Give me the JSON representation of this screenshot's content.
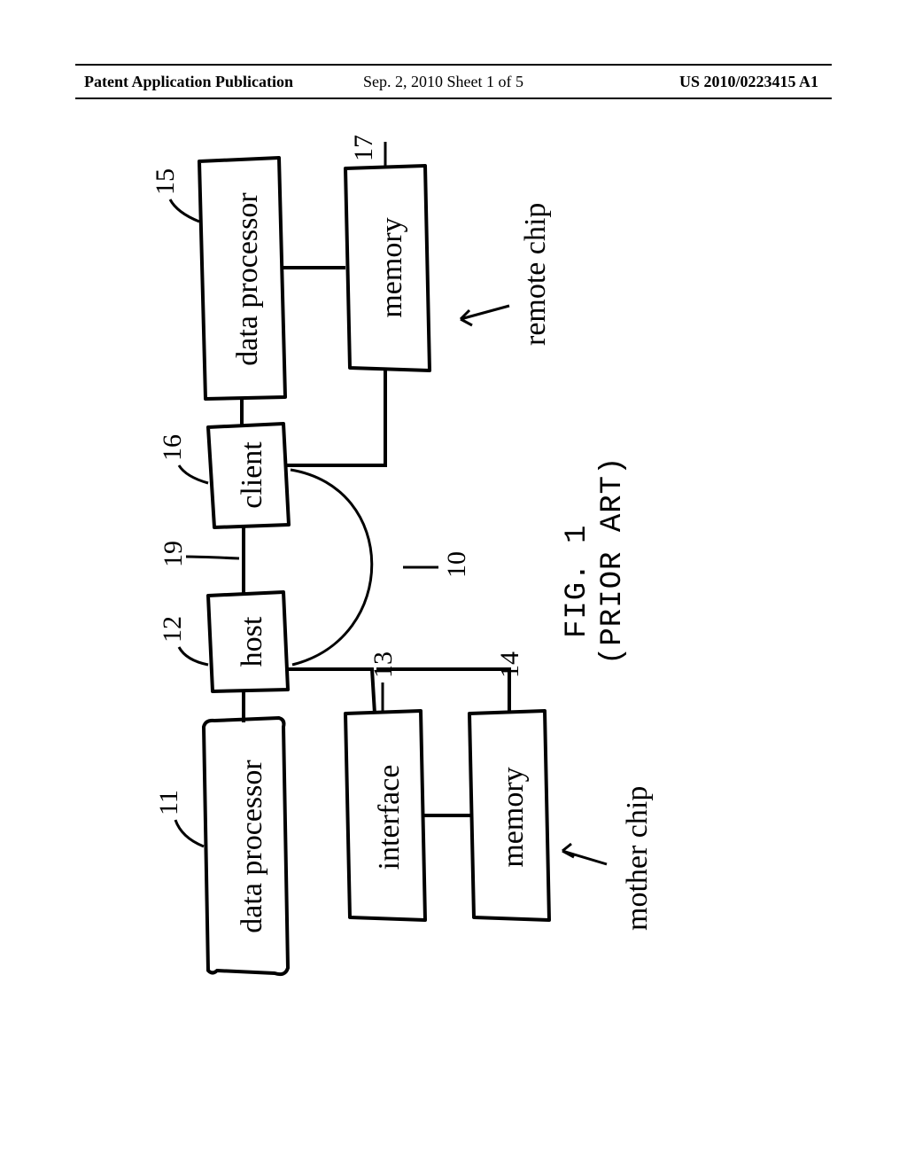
{
  "header": {
    "left": "Patent Application Publication",
    "center": "Sep. 2, 2010  Sheet 1 of 5",
    "right": "US 2010/0223415 A1"
  },
  "figure": {
    "caption_line1": "FIG. 1",
    "caption_line2": "(PRIOR ART)",
    "mother_chip_label": "mother chip",
    "remote_chip_label": "remote chip",
    "blocks": {
      "data_processor_left": "data processor",
      "host": "host",
      "interface": "interface",
      "memory_left": "memory",
      "client": "client",
      "data_processor_right": "data processor",
      "memory_right": "memory"
    },
    "refs": {
      "dp_left": "11",
      "host": "12",
      "interface": "13",
      "memory_left": "14",
      "dp_right": "15",
      "client": "16",
      "memory_right": "17",
      "bus": "19",
      "link": "10"
    }
  }
}
